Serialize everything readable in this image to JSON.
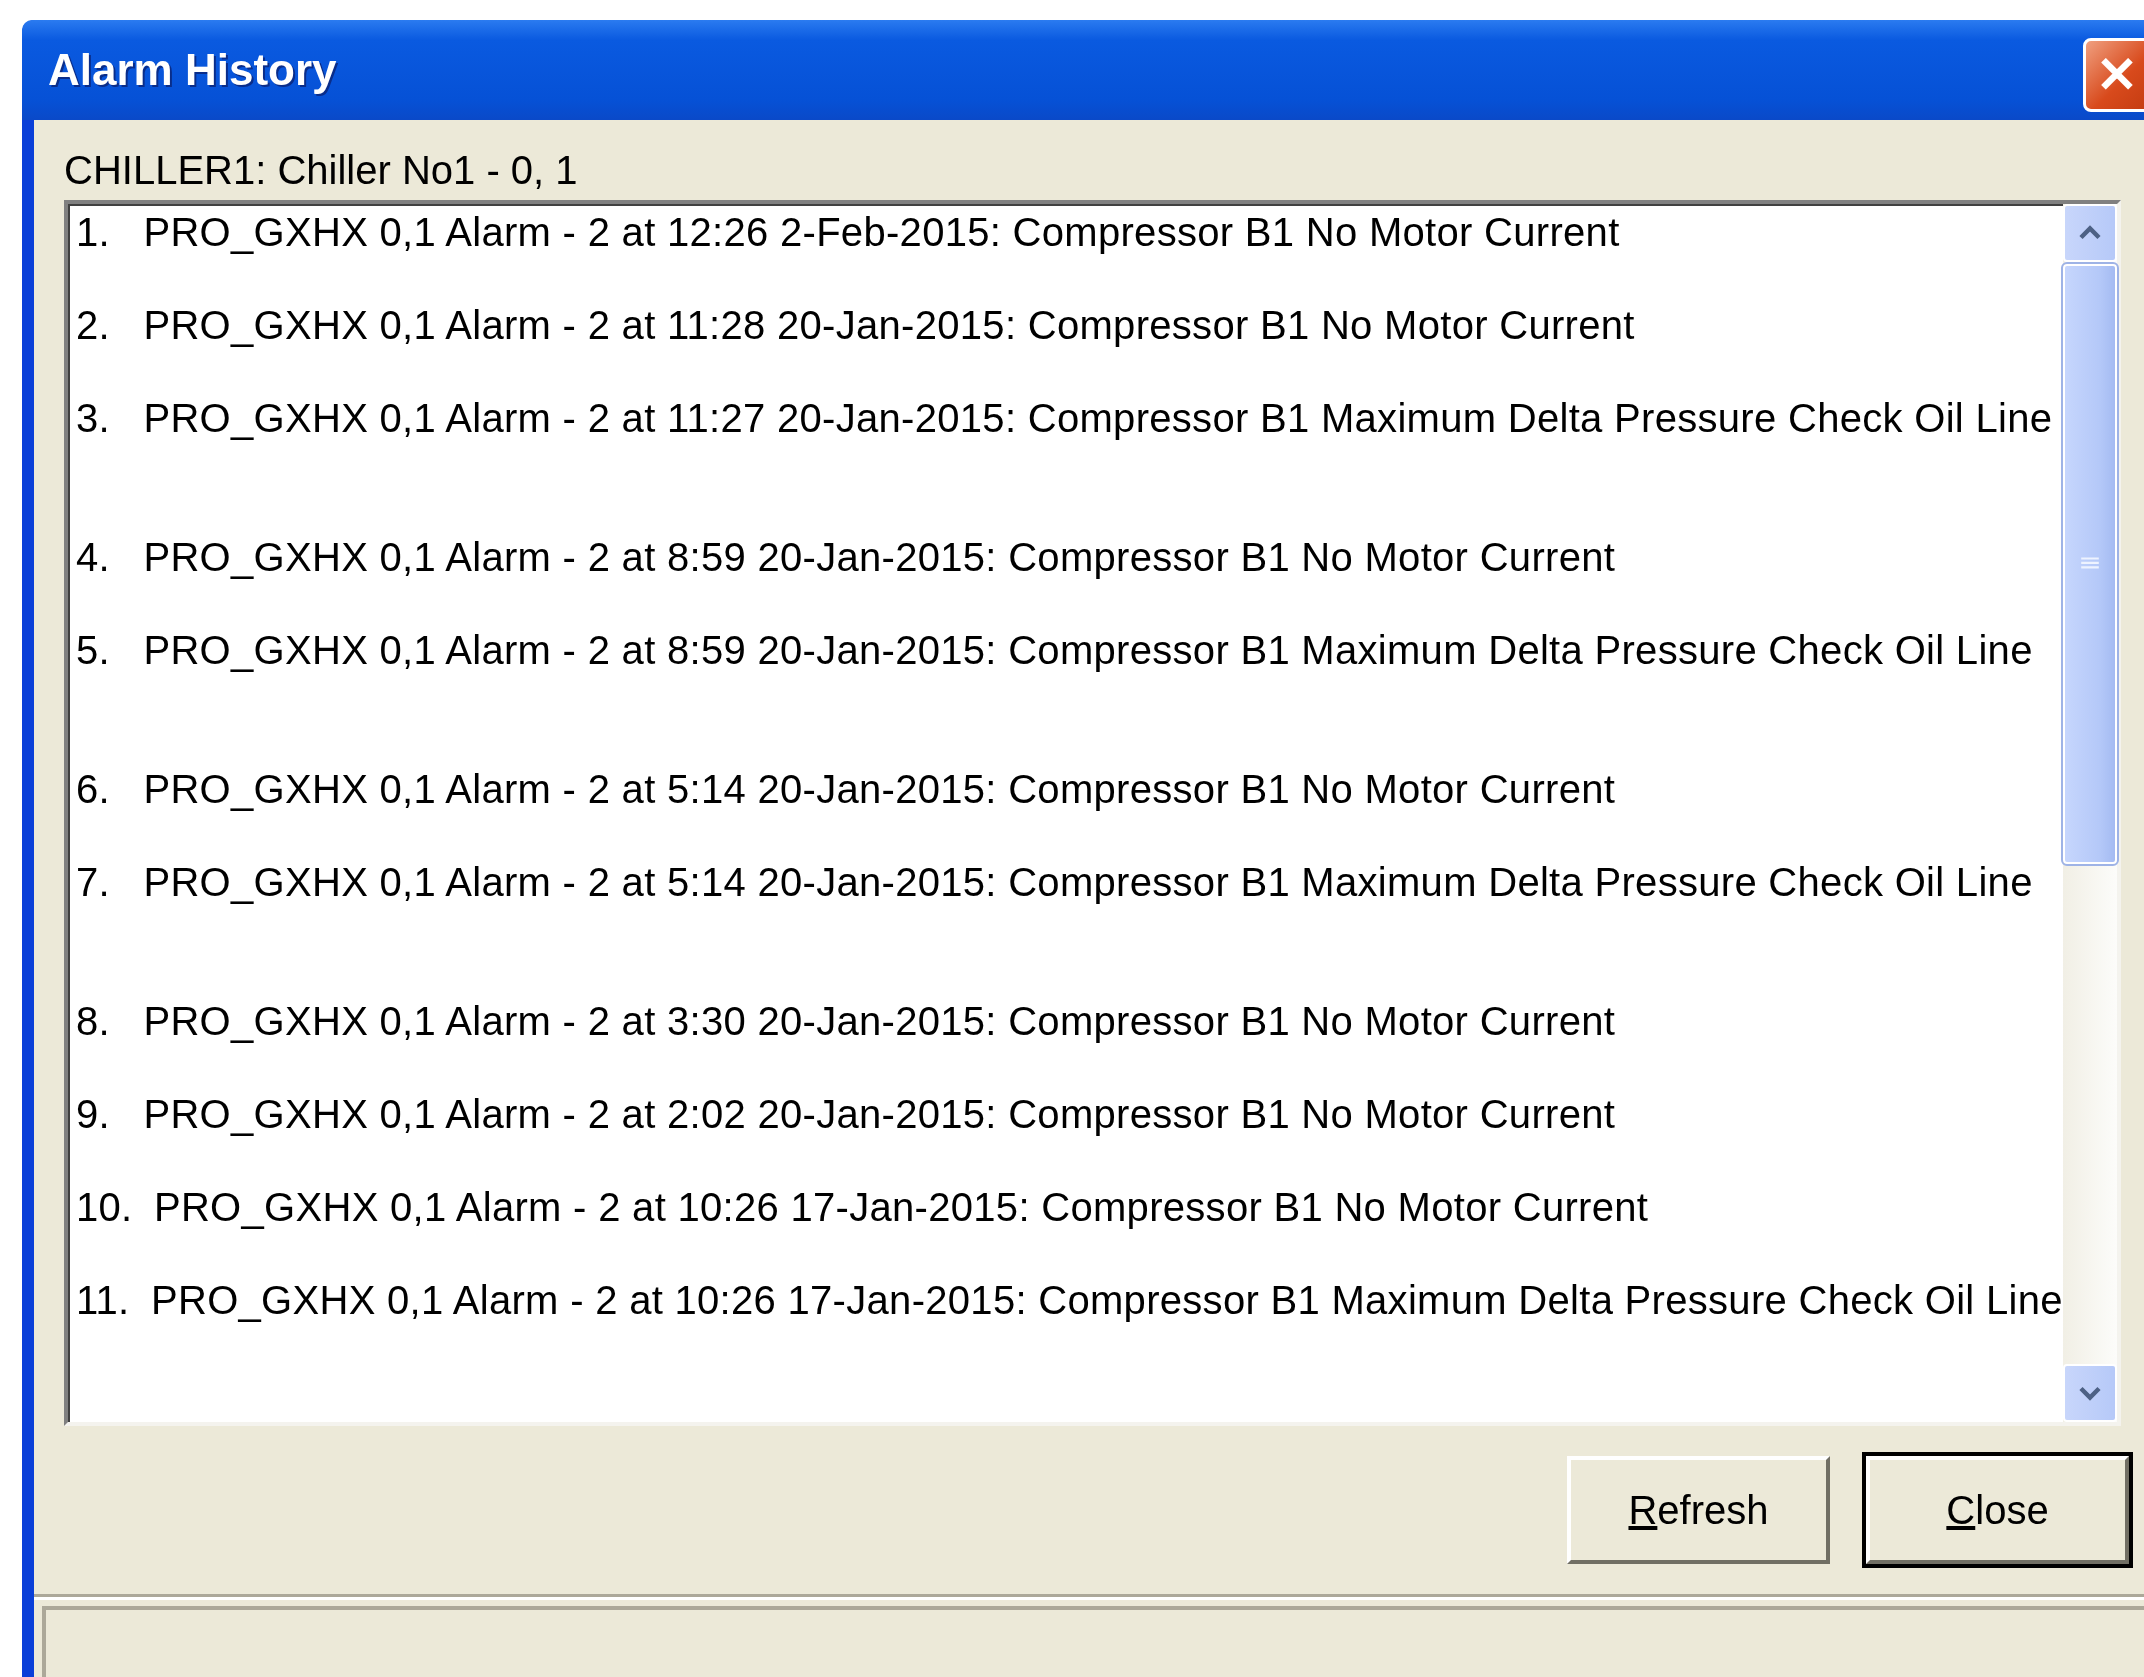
{
  "window": {
    "title": "Alarm History",
    "close_glyph": "✕"
  },
  "source_label": "CHILLER1: Chiller No1 - 0, 1",
  "alarms": [
    {
      "number": "1.",
      "text": "PRO_GXHX 0,1 Alarm - 2 at 12:26 2-Feb-2015: Compressor B1 No Motor Current",
      "wrapped": false
    },
    {
      "number": "2.",
      "text": "PRO_GXHX 0,1 Alarm - 2 at 11:28 20-Jan-2015: Compressor B1 No Motor Current",
      "wrapped": false
    },
    {
      "number": "3.",
      "text": "PRO_GXHX 0,1 Alarm - 2 at 11:27 20-Jan-2015: Compressor B1 Maximum Delta Pressure Check Oil Line",
      "wrapped": true
    },
    {
      "number": "4.",
      "text": "PRO_GXHX 0,1 Alarm - 2 at 8:59 20-Jan-2015: Compressor B1 No Motor Current",
      "wrapped": false
    },
    {
      "number": "5.",
      "text": "PRO_GXHX 0,1 Alarm - 2 at 8:59 20-Jan-2015: Compressor B1 Maximum Delta Pressure Check Oil Line",
      "wrapped": true
    },
    {
      "number": "6.",
      "text": "PRO_GXHX 0,1 Alarm - 2 at 5:14 20-Jan-2015: Compressor B1 No Motor Current",
      "wrapped": false
    },
    {
      "number": "7.",
      "text": "PRO_GXHX 0,1 Alarm - 2 at 5:14 20-Jan-2015: Compressor B1 Maximum Delta Pressure Check Oil Line",
      "wrapped": true
    },
    {
      "number": "8.",
      "text": "PRO_GXHX 0,1 Alarm - 2 at 3:30 20-Jan-2015: Compressor B1 No Motor Current",
      "wrapped": false
    },
    {
      "number": "9.",
      "text": "PRO_GXHX 0,1 Alarm - 2 at 2:02 20-Jan-2015: Compressor B1 No Motor Current",
      "wrapped": false
    },
    {
      "number": "10.",
      "text": "PRO_GXHX 0,1 Alarm - 2 at 10:26 17-Jan-2015: Compressor B1 No Motor Current",
      "wrapped": false
    },
    {
      "number": "11.",
      "text": "PRO_GXHX 0,1 Alarm - 2 at 10:26 17-Jan-2015: Compressor B1 Maximum Delta Pressure Check Oil Line",
      "wrapped": true
    }
  ],
  "buttons": [
    {
      "label": "Refresh",
      "mnemonic": true,
      "default": false
    },
    {
      "label": "Close",
      "mnemonic": true,
      "default": true
    }
  ]
}
